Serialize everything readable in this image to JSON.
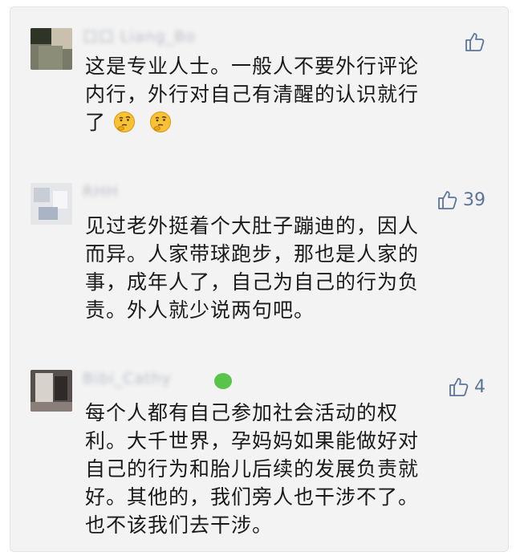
{
  "comments": [
    {
      "author": "口口 Liang_Bo",
      "likes": "",
      "text_lines": [
        "这是专业人士。一般人不要外行评论",
        "内行，外行对自己有清醒的认识就行"
      ],
      "last_line": "了",
      "emoji": "thinking-face-icon",
      "avatar_colors": [
        "#6f7060",
        "#2e3527",
        "#c9c1ad",
        "#8c8d78"
      ]
    },
    {
      "author": "RHH",
      "likes": "39",
      "text_lines": [
        "见过老外挺着个大肚子蹦迪的，因人",
        "而异。人家带球跑步，那也是人家的",
        "事，成年人了，自己为自己的行为负",
        "责。外人就少说两句吧。"
      ],
      "avatar_colors": [
        "#e8eaee",
        "#c9cdd6",
        "#f3f4f6",
        "#a9b4c4"
      ]
    },
    {
      "author": "Bibi_Cathy",
      "likes": "4",
      "text_lines": [
        "每个人都有自己参加社会活动的权",
        "利。大千世界，孕妈妈如果能做好对",
        "自己的行为和胎儿后续的发展负责就",
        "好。其他的，我们旁人也干涉不了。",
        "也不该我们去干涉。"
      ],
      "avatar_colors": [
        "#55504d",
        "#d8d2cc",
        "#2d2a29",
        "#8a7f78"
      ]
    }
  ],
  "colors": {
    "background": "#f3f3f3",
    "like": "#5b7599",
    "text": "#1a1a1a"
  }
}
